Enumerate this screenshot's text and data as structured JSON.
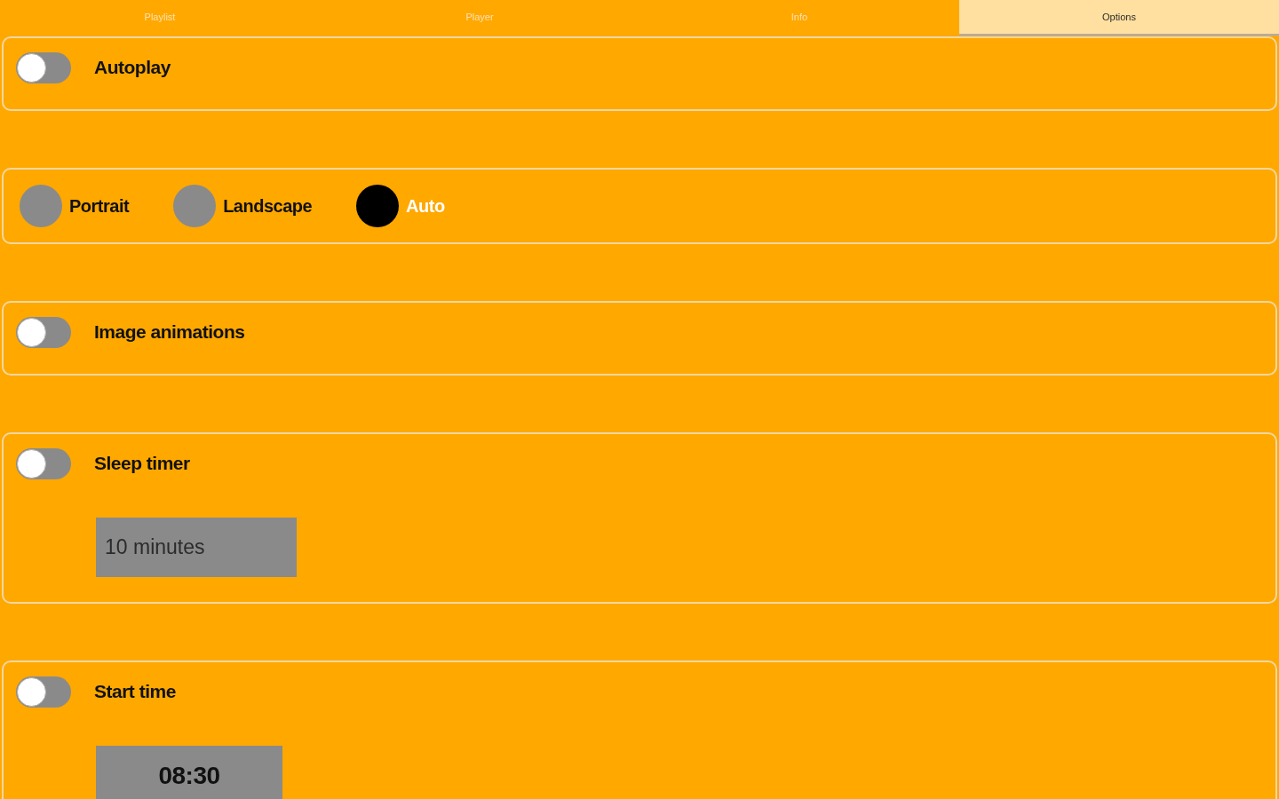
{
  "tabs": [
    {
      "label": "Playlist",
      "selected": false
    },
    {
      "label": "Player",
      "selected": false
    },
    {
      "label": "Info",
      "selected": false
    },
    {
      "label": "Options",
      "selected": true
    }
  ],
  "settings": [
    {
      "kind": "toggle",
      "label": "Autoplay",
      "on": false
    },
    {
      "kind": "radio_group",
      "options": [
        {
          "label": "Portrait",
          "selected": false
        },
        {
          "label": "Landscape",
          "selected": false
        },
        {
          "label": "Auto",
          "selected": true
        }
      ]
    },
    {
      "kind": "toggle",
      "label": "Image animations",
      "on": false
    },
    {
      "kind": "toggle",
      "label": "Sleep timer",
      "on": false,
      "field": {
        "kind": "duration",
        "value": "10 minutes"
      }
    },
    {
      "kind": "toggle",
      "label": "Start time",
      "on": false,
      "field": {
        "kind": "time",
        "value": "08:30"
      }
    }
  ]
}
